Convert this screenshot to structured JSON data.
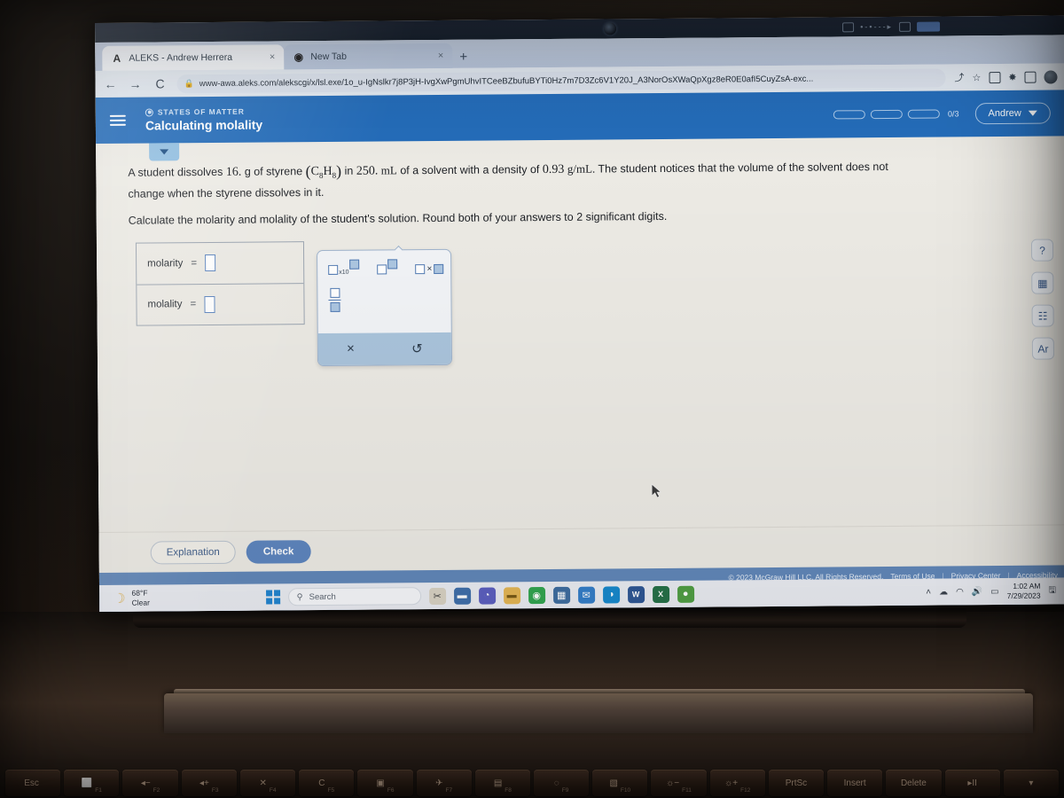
{
  "browser": {
    "tabs": [
      {
        "title": "ALEKS - Andrew Herrera",
        "favicon": "A",
        "close": "×",
        "active": true
      },
      {
        "title": "New Tab",
        "favicon": "◉",
        "close": "×",
        "active": false
      }
    ],
    "new_tab_label": "+",
    "nav": {
      "back": "←",
      "forward": "→",
      "reload": "C"
    },
    "url": "www-awa.aleks.com/alekscgi/x/lsl.exe/1o_u-IgNslkr7j8P3jH-IvgXwPgmUhvITCeeBZbufuBYTi0Hz7m7D3Zc6V1Y20J_A3NorOsXWaQpXgz8eR0E0afI5CuyZsA-exc...",
    "lock_icon": "🔒",
    "share_icon": "⤴",
    "star_icon": "☆",
    "extension_icon": "✸"
  },
  "aleks": {
    "kicker": "STATES OF MATTER",
    "lesson_title": "Calculating molality",
    "progress": {
      "segments": 3,
      "count": "0/3"
    },
    "user": {
      "name": "Andrew"
    },
    "question": {
      "line1_a": "A student dissolves",
      "amount": "16.",
      "line1_b": "g of styrene",
      "formula": "C8H8",
      "line1_c": "in",
      "volume": "250.",
      "volume_unit": "mL",
      "line1_d": "of a solvent with a density of",
      "density": "0.93",
      "density_unit": "g/mL.",
      "line1_e": "The student notices that the volume of the solvent does not",
      "line2": "change when the styrene dissolves in it.",
      "line3": "Calculate the molarity and molality of the student's solution. Round both of your answers to 2 significant digits."
    },
    "answers": [
      {
        "label": "molarity",
        "equals": "=",
        "value": ""
      },
      {
        "label": "molality",
        "equals": "=",
        "value": ""
      }
    ],
    "palette": {
      "buttons": [
        "sub-x10-button",
        "superscript-button",
        "multiply-button",
        "fraction-button"
      ],
      "x10_label": "x10",
      "times_label": "×",
      "clear_label": "×",
      "undo_label": "↺"
    },
    "buttons": {
      "explanation": "Explanation",
      "check": "Check"
    },
    "tool_rail": [
      {
        "name": "help-icon",
        "glyph": "?"
      },
      {
        "name": "calculator-icon",
        "glyph": "▦"
      },
      {
        "name": "chart-icon",
        "glyph": "☷"
      },
      {
        "name": "periodic-table-icon",
        "glyph": "Ar"
      }
    ],
    "footer": {
      "copyright": "© 2023 McGraw Hill LLC. All Rights Reserved.",
      "terms": "Terms of Use",
      "privacy": "Privacy Center",
      "accessibility": "Accessibility",
      "separator": "|"
    }
  },
  "taskbar": {
    "weather": {
      "temp": "68°F",
      "condition": "Clear",
      "icon": "☽"
    },
    "search": {
      "placeholder": "Search",
      "icon": "⚲"
    },
    "apps": [
      {
        "name": "start-button",
        "glyph": "",
        "color": "#1b86d8"
      },
      {
        "name": "snipping-tool-icon",
        "glyph": "✂",
        "color": "#d8d2c4"
      },
      {
        "name": "file-explorer-icon",
        "glyph": "🗀",
        "color": "#e8b64c"
      },
      {
        "name": "teams-icon",
        "glyph": "◔",
        "color": "#5b5fc7"
      },
      {
        "name": "folder-icon",
        "glyph": "▬",
        "color": "#e8b64c"
      },
      {
        "name": "chrome-icon",
        "glyph": "◉",
        "color": "#2aa84a"
      },
      {
        "name": "calculator-icon",
        "glyph": "▦",
        "color": "#3b6ea5"
      },
      {
        "name": "mail-icon",
        "glyph": "✉",
        "color": "#2f7fd0"
      },
      {
        "name": "edge-icon",
        "glyph": "◑",
        "color": "#0f8bd4"
      },
      {
        "name": "word-icon",
        "glyph": "W",
        "color": "#2b579a"
      },
      {
        "name": "excel-icon",
        "glyph": "X",
        "color": "#217346"
      },
      {
        "name": "aleks-icon",
        "glyph": "●",
        "color": "#4ba03f"
      }
    ],
    "tray": {
      "chevron": "˄",
      "onedrive": "☁",
      "wifi": "◠",
      "volume": "🔊",
      "battery": "▭",
      "time": "1:02 AM",
      "date": "7/29/2023",
      "notification": "🖫"
    }
  },
  "keyboard": {
    "keys": [
      {
        "glyph": "Esc",
        "fn": ""
      },
      {
        "glyph": "⬜",
        "fn": "F1"
      },
      {
        "glyph": "◂−",
        "fn": "F2"
      },
      {
        "glyph": "◂+",
        "fn": "F3"
      },
      {
        "glyph": "✕",
        "fn": "F4"
      },
      {
        "glyph": "C",
        "fn": "F5"
      },
      {
        "glyph": "▣",
        "fn": "F6"
      },
      {
        "glyph": "✈",
        "fn": "F7"
      },
      {
        "glyph": "▤",
        "fn": "F8"
      },
      {
        "glyph": "◌",
        "fn": "F9"
      },
      {
        "glyph": "▧",
        "fn": "F10"
      },
      {
        "glyph": "☼−",
        "fn": "F11"
      },
      {
        "glyph": "☼+",
        "fn": "F12"
      },
      {
        "glyph": "PrtSc",
        "fn": ""
      },
      {
        "glyph": "Insert",
        "fn": ""
      },
      {
        "glyph": "Delete",
        "fn": ""
      },
      {
        "glyph": "▸II",
        "fn": ""
      },
      {
        "glyph": "▾",
        "fn": ""
      }
    ]
  },
  "bezel": {
    "widget_dots": "•‑•‑‑‑▸"
  }
}
